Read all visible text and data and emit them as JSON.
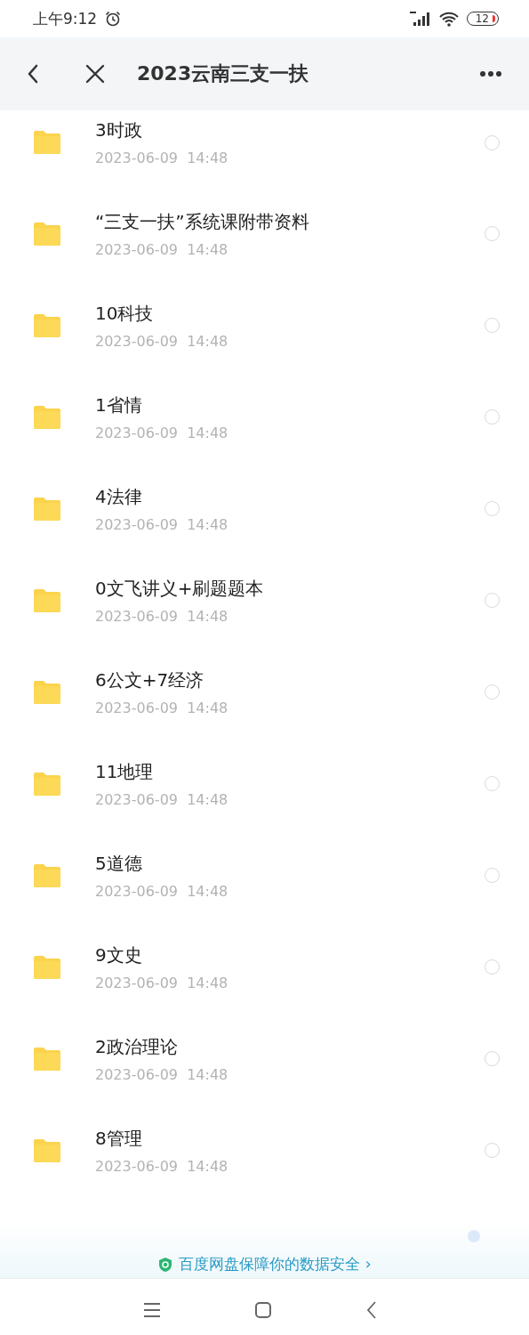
{
  "status_bar": {
    "time": "上午9:12",
    "battery": "12"
  },
  "header": {
    "title": "2023云南三支一扶"
  },
  "files": [
    {
      "name": "3时政",
      "modified": "2023-06-09  14:48",
      "selected": false
    },
    {
      "name": "“三支一扶”系统课附带资料",
      "modified": "2023-06-09  14:48",
      "selected": false
    },
    {
      "name": "10科技",
      "modified": "2023-06-09  14:48",
      "selected": false
    },
    {
      "name": "1省情",
      "modified": "2023-06-09  14:48",
      "selected": false
    },
    {
      "name": "4法律",
      "modified": "2023-06-09  14:48",
      "selected": false
    },
    {
      "name": "0文飞讲义+刷题题本",
      "modified": "2023-06-09  14:48",
      "selected": false
    },
    {
      "name": "6公文+7经济",
      "modified": "2023-06-09  14:48",
      "selected": false
    },
    {
      "name": "11地理",
      "modified": "2023-06-09  14:48",
      "selected": false
    },
    {
      "name": "5道德",
      "modified": "2023-06-09  14:48",
      "selected": false
    },
    {
      "name": "9文史",
      "modified": "2023-06-09  14:48",
      "selected": false
    },
    {
      "name": "2政治理论",
      "modified": "2023-06-09  14:48",
      "selected": false
    },
    {
      "name": "8管理",
      "modified": "2023-06-09  14:48",
      "selected": false
    }
  ],
  "banner": {
    "text": "百度网盘保障你的数据安全 ›"
  }
}
